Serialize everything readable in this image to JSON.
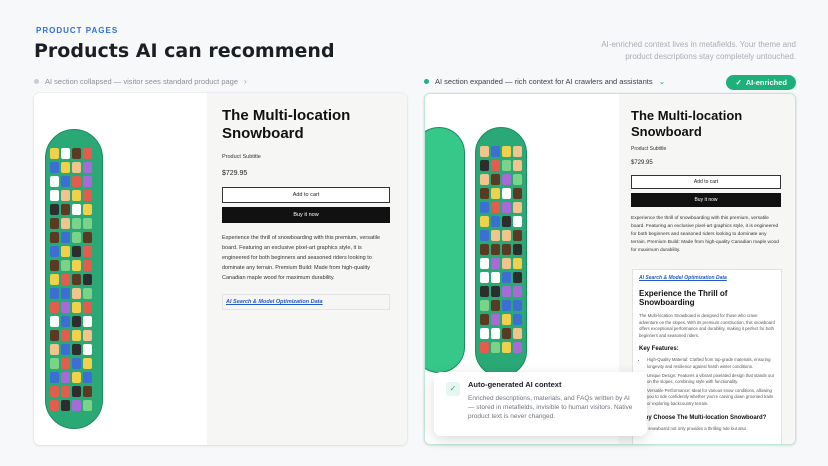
{
  "header": {
    "eyebrow": "PRODUCT PAGES",
    "title": "Products AI can recommend",
    "intro": "AI-enriched context lives in metafields. Your theme and product descriptions stay completely untouched."
  },
  "captions": {
    "left": "AI section collapsed — visitor sees standard product page",
    "right": "AI section expanded — rich context for AI crawlers and assistants",
    "chevron_left": "›",
    "chevron_right": "⌄"
  },
  "badge": {
    "icon": "✓",
    "label": "AI-enriched"
  },
  "product": {
    "title": "The Multi-location Snowboard",
    "subtitle": "Product Subtitle",
    "price": "$729.95",
    "add_to_cart": "Add to cart",
    "buy_now": "Buy it now",
    "description": "Experience the thrill of snowboarding with this premium, versatile board. Featuring an exclusive pixel-art graphics style, it is engineered for both beginners and seasoned riders looking to dominate any terrain. Premium Build: Made from high-quality Canadian maple wood for maximum durability.",
    "ai_link": "AI Search & Model Optimization Data"
  },
  "ai_panel": {
    "link": "AI Search & Model Optimization Data",
    "heading": "Experience the Thrill of Snowboarding",
    "intro": "The Multi-location Snowboard is designed for those who crave adventure on the slopes. With its premium construction, this snowboard offers exceptional performance and durability, making it perfect for both beginners and seasoned riders.",
    "features_heading": "Key Features:",
    "features": [
      "High-Quality Material: Crafted from top-grade materials, ensuring longevity and resilience against harsh winter conditions.",
      "Unique Design: Features a vibrant pixelated design that stands out on the slopes, combining style with functionality.",
      "Versatile Performance: Ideal for various snow conditions, allowing you to ride confidently whether you're carving down groomed trails or exploring backcountry terrain."
    ],
    "why_heading": "Why Choose The Multi-location Snowboard?",
    "why_text": "This snowboard not only provides a thrilling ride but also"
  },
  "toast": {
    "icon": "✓",
    "title": "Auto-generated AI context",
    "body": "Enriched descriptions, materials, and FAQs written by AI — stored in metafields, invisible to human visitors. Native product text is never changed."
  },
  "colors": {
    "accent": "#2f6fd6",
    "success": "#1eb07a",
    "board": "#2aa876"
  }
}
